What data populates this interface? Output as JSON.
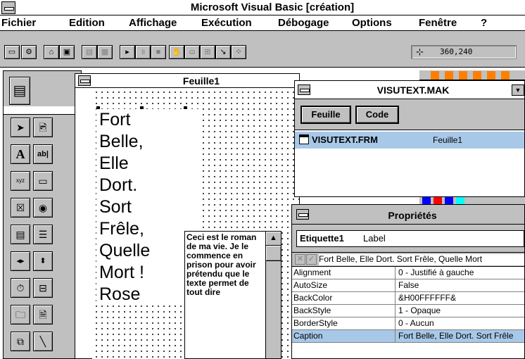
{
  "app": {
    "title": "Microsoft Visual Basic [création]"
  },
  "menu": [
    {
      "label": "Fichier"
    },
    {
      "label": "Edition"
    },
    {
      "label": "Affichage"
    },
    {
      "label": "Exécution"
    },
    {
      "label": "Débogage"
    },
    {
      "label": "Options"
    },
    {
      "label": "Fenêtre"
    },
    {
      "label": "?"
    }
  ],
  "toolbar": {
    "coordinates": "360,240"
  },
  "form": {
    "title": "Feuille1",
    "lines": [
      "Fort",
      "Belle,",
      "Elle",
      "Dort.",
      "Sort",
      "Frêle,",
      "Quelle",
      "Mort !",
      "Rose"
    ],
    "textbox_text": "Ceci est le roman de ma vie. Je le commence en prison pour avoir prétendu que le texte permet de tout dire"
  },
  "project": {
    "title": "VISUTEXT.MAK",
    "buttons": {
      "form": "Feuille",
      "code": "Code"
    },
    "file": "VISUTEXT.FRM",
    "form_name": "Feuille1"
  },
  "properties": {
    "title": "Propriétés",
    "object_name": "Etiquette1",
    "object_type": "Label",
    "edit_value": "Fort Belle, Elle Dort. Sort Frêle, Quelle Mort",
    "rows": [
      {
        "name": "Alignment",
        "value": "0 - Justifié à gauche"
      },
      {
        "name": "AutoSize",
        "value": "False"
      },
      {
        "name": "BackColor",
        "value": "&H00FFFFFF&"
      },
      {
        "name": "BackStyle",
        "value": "1 - Opaque"
      },
      {
        "name": "BorderStyle",
        "value": "0 - Aucun"
      },
      {
        "name": "Caption",
        "value": "Fort Belle, Elle Dort. Sort Frêle"
      }
    ]
  },
  "colors": {
    "selection": "#a8c8e8",
    "face": "#c0c0c0"
  }
}
